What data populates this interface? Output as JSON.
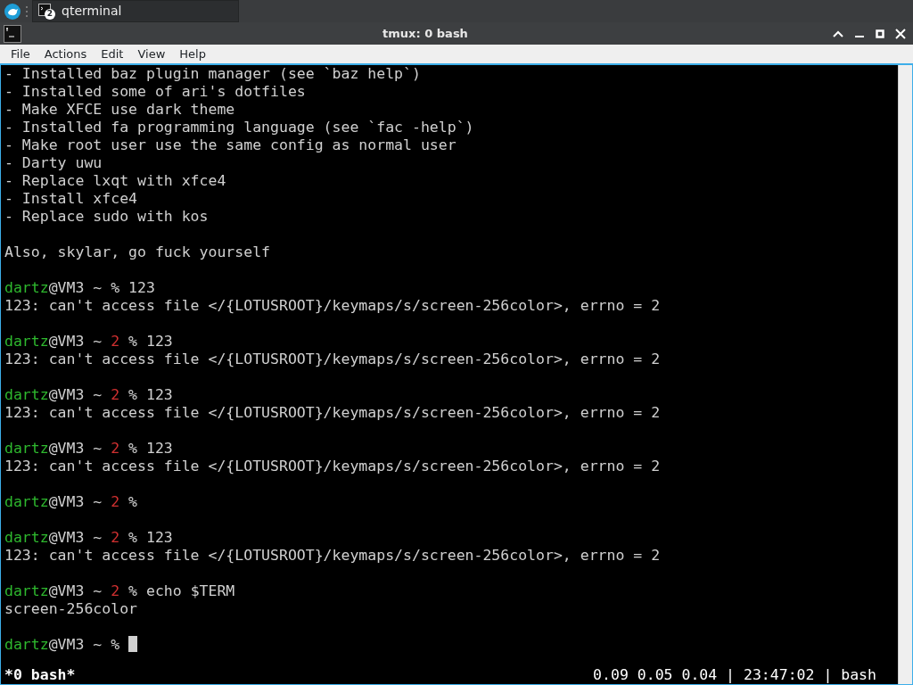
{
  "taskbar": {
    "task": {
      "label": "qterminal",
      "count": "2"
    }
  },
  "window": {
    "title": "tmux: 0 bash"
  },
  "menu": [
    "File",
    "Actions",
    "Edit",
    "View",
    "Help"
  ],
  "terminal": {
    "lines": [
      {
        "kind": "text",
        "text": "- Installed baz plugin manager (see `baz help`)"
      },
      {
        "kind": "text",
        "text": "- Installed some of ari's dotfiles"
      },
      {
        "kind": "text",
        "text": "- Make XFCE use dark theme"
      },
      {
        "kind": "text",
        "text": "- Installed fa programming language (see `fac -help`)"
      },
      {
        "kind": "text",
        "text": "- Make root user use the same config as normal user"
      },
      {
        "kind": "text",
        "text": "- Darty uwu"
      },
      {
        "kind": "text",
        "text": "- Replace lxqt with xfce4"
      },
      {
        "kind": "text",
        "text": "- Install xfce4"
      },
      {
        "kind": "text",
        "text": "- Replace sudo with kos"
      },
      {
        "kind": "blank"
      },
      {
        "kind": "text",
        "text": "Also, skylar, go fuck yourself"
      },
      {
        "kind": "blank"
      },
      {
        "kind": "prompt",
        "user": "dartz",
        "host": "@VM3 ~",
        "symbol": "%",
        "command": "123"
      },
      {
        "kind": "text",
        "text": "123: can't access file </{LOTUSROOT}/keymaps/s/screen-256color>, errno = 2"
      },
      {
        "kind": "blank"
      },
      {
        "kind": "prompt",
        "user": "dartz",
        "host": "@VM3 ~",
        "exit_code": "2",
        "symbol": "%",
        "command": "123"
      },
      {
        "kind": "text",
        "text": "123: can't access file </{LOTUSROOT}/keymaps/s/screen-256color>, errno = 2"
      },
      {
        "kind": "blank"
      },
      {
        "kind": "prompt",
        "user": "dartz",
        "host": "@VM3 ~",
        "exit_code": "2",
        "symbol": "%",
        "command": "123"
      },
      {
        "kind": "text",
        "text": "123: can't access file </{LOTUSROOT}/keymaps/s/screen-256color>, errno = 2"
      },
      {
        "kind": "blank"
      },
      {
        "kind": "prompt",
        "user": "dartz",
        "host": "@VM3 ~",
        "exit_code": "2",
        "symbol": "%",
        "command": "123"
      },
      {
        "kind": "text",
        "text": "123: can't access file </{LOTUSROOT}/keymaps/s/screen-256color>, errno = 2"
      },
      {
        "kind": "blank"
      },
      {
        "kind": "prompt",
        "user": "dartz",
        "host": "@VM3 ~",
        "exit_code": "2",
        "symbol": "%"
      },
      {
        "kind": "blank"
      },
      {
        "kind": "prompt",
        "user": "dartz",
        "host": "@VM3 ~",
        "exit_code": "2",
        "symbol": "%",
        "command": "123"
      },
      {
        "kind": "text",
        "text": "123: can't access file </{LOTUSROOT}/keymaps/s/screen-256color>, errno = 2"
      },
      {
        "kind": "blank"
      },
      {
        "kind": "prompt",
        "user": "dartz",
        "host": "@VM3 ~",
        "exit_code": "2",
        "symbol": "%",
        "command": "echo $TERM"
      },
      {
        "kind": "text",
        "text": "screen-256color"
      },
      {
        "kind": "blank"
      },
      {
        "kind": "prompt",
        "user": "dartz",
        "host": "@VM3 ~",
        "symbol": "%",
        "cursor": true
      }
    ],
    "status_bar": {
      "window": "*0 bash*",
      "info": "0.09 0.05 0.04 | 23:47:02 | bash"
    }
  }
}
